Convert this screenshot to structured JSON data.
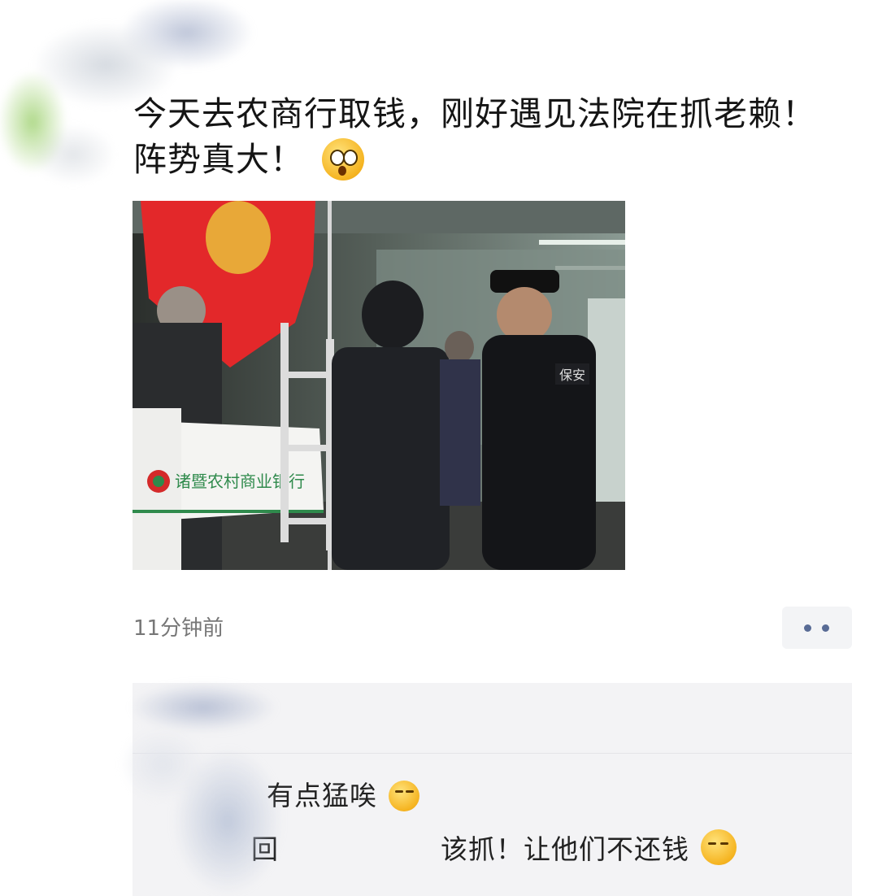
{
  "post": {
    "text": "今天去农商行取钱，刚好遇见法院在抓老赖！阵势真大！",
    "emoji": "flushed-face-emoji",
    "photo_sign_text": "诸暨农村商业银行",
    "guard_patch_text": "保安"
  },
  "meta": {
    "timestamp": "11分钟前"
  },
  "comments": [
    {
      "text": "有点猛唉",
      "emoji": "flushed-face-emoji"
    },
    {
      "prefix": "回",
      "text": "该抓！让他们不还钱",
      "emoji": "unamused-face-emoji"
    }
  ],
  "colors": {
    "timestamp": "#777777",
    "comments_bg": "#f3f3f5",
    "more_dots": "#586b95",
    "flag_red": "#e3282a",
    "bank_green": "#2f8a4c"
  }
}
